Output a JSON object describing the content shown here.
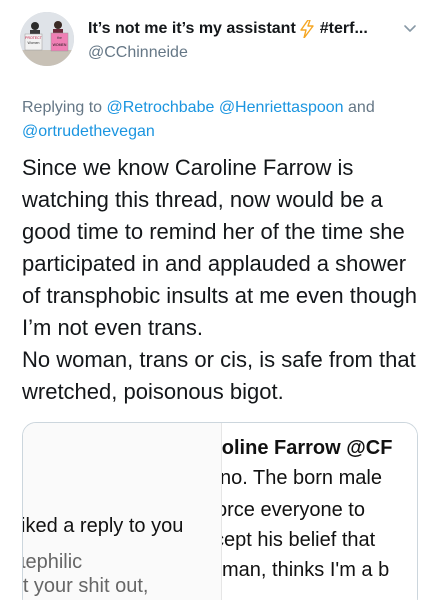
{
  "tweet": {
    "display_name": "It’s not me it’s my assistant",
    "name_suffix": "#terf...",
    "handle": "@CChinneide",
    "avatar_sign_texts": [
      "PROTECT",
      "Women",
      "the",
      "WOMEN"
    ],
    "replying": {
      "prefix": "Replying to",
      "mentions": [
        "@Retrochbabe",
        "@Henriettaspoon",
        "@ortrudethevegan"
      ],
      "conjunction": "and"
    },
    "body_paragraphs": [
      "Since we know Caroline Farrow is watching this thread, now would be a good time to remind her of the time she participated in and applauded a shower of transphobic insults at me even though I’m not even trans.",
      "No woman, trans or cis, is safe from that wretched, poisonous bigot."
    ]
  },
  "media": {
    "left_lines": [
      "iked a reply to you",
      "ɩephilic",
      "'t your shit out,"
    ],
    "right_lines": [
      "roline Farrow @CF",
      "no. The born male",
      "orce everyone to",
      "cept his belief that",
      "man, thinks I'm a b"
    ]
  },
  "colors": {
    "text": "#14171a",
    "secondary": "#657786",
    "link": "#1b95e0",
    "bolt": "#f5a623",
    "border": "#ccd6dd"
  },
  "icons": {
    "bolt": "lightning-bolt-icon",
    "chevron": "chevron-down-icon"
  }
}
